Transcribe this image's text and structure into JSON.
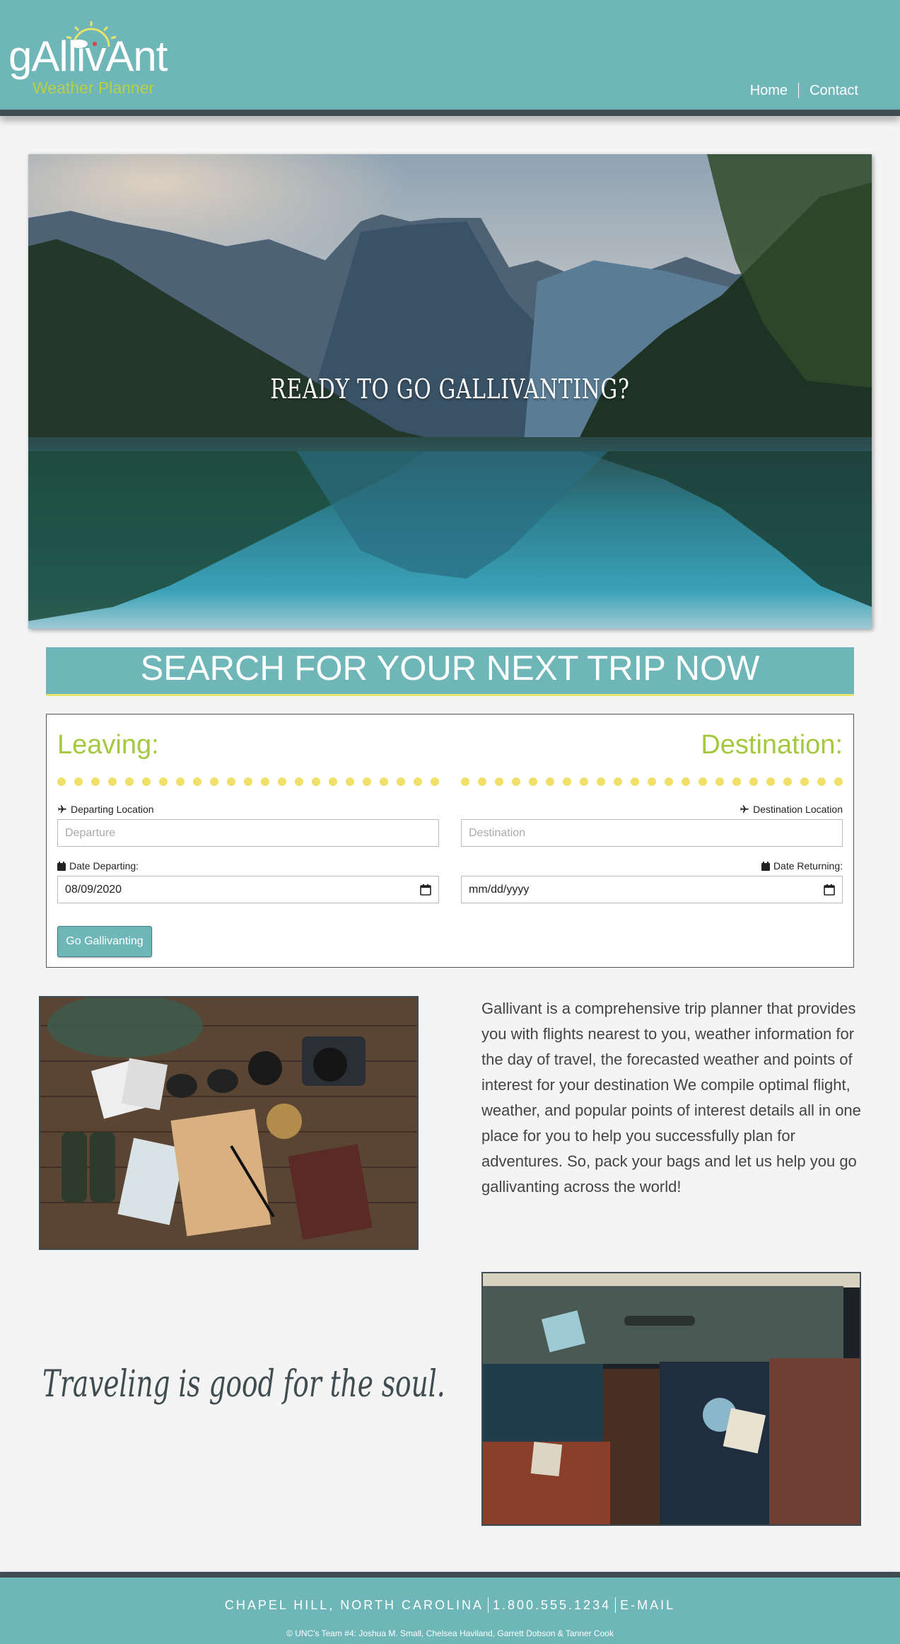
{
  "header": {
    "logo_text": "gAllivAnt",
    "logo_subtitle": "Weather Planner",
    "nav": [
      {
        "label": "Home"
      },
      {
        "label": "Contact"
      }
    ]
  },
  "hero": {
    "title": "READY TO GO GALLIVANTING?"
  },
  "search": {
    "banner_title": "SEARCH FOR YOUR NEXT TRIP NOW",
    "leaving_title": "Leaving:",
    "destination_title": "Destination:",
    "departing_location_label": "Departing Location",
    "destination_location_label": "Destination Location",
    "departure_placeholder": "Departure",
    "destination_placeholder": "Destination",
    "date_departing_label": "Date Departing:",
    "date_returning_label": "Date Returning:",
    "date_departing_value": "08/09/2020",
    "date_returning_value": "mm/dd/yyyy",
    "submit_label": "Go Gallivanting"
  },
  "about": {
    "text": "Gallivant is a comprehensive trip planner that provides you with flights nearest to you, weather information for the day of travel, the forecasted weather and points of interest for your destination We compile optimal flight, weather, and popular points of interest details all in one place for you to help you successfully plan for adventures. So, pack your bags and let us help you go gallivanting across the world!",
    "quote": "Traveling is good for the soul."
  },
  "footer": {
    "location": "CHAPEL HILL, NORTH CAROLINA",
    "phone": "1.800.555.1234",
    "email": "E-MAIL",
    "copyright": "© UNC's Team #4: Joshua M. Small, Chelsea Haviland, Garrett Dobson & Tanner Cook"
  },
  "colors": {
    "teal": "#6fb6b8",
    "dark": "#3f4d52",
    "green_accent": "#a4c93e",
    "yellow_accent": "#f0e067"
  }
}
